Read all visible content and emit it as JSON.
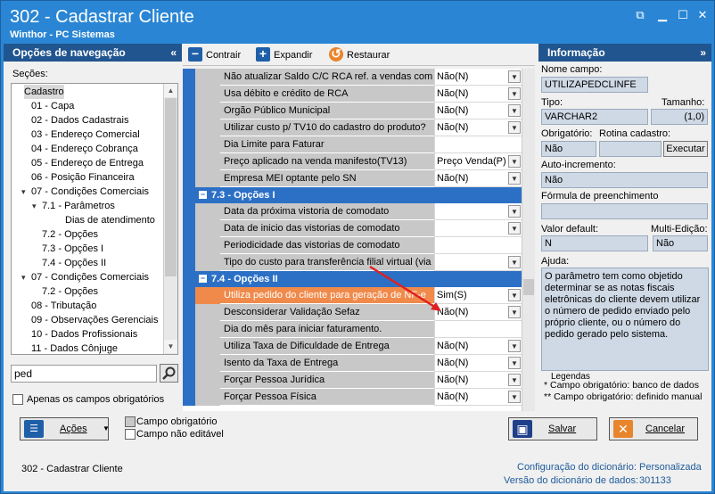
{
  "window": {
    "title": "302 - Cadastrar Cliente",
    "subtitle": "Winthor - PC Sistemas"
  },
  "nav": {
    "header": "Opções de navegação",
    "sections_label": "Seções:",
    "items": [
      {
        "label": "Cadastro",
        "level": 0,
        "twisty": ""
      },
      {
        "label": "01 - Capa",
        "level": 1,
        "twisty": ""
      },
      {
        "label": "02 - Dados Cadastrais",
        "level": 1,
        "twisty": ""
      },
      {
        "label": "03 - Endereço Comercial",
        "level": 1,
        "twisty": ""
      },
      {
        "label": "04 - Endereço Cobrança",
        "level": 1,
        "twisty": ""
      },
      {
        "label": "05 - Endereço de Entrega",
        "level": 1,
        "twisty": ""
      },
      {
        "label": "06 - Posição Financeira",
        "level": 1,
        "twisty": ""
      },
      {
        "label": "07 - Condições Comerciais",
        "level": 1,
        "twisty": "▾"
      },
      {
        "label": "7.1 - Parâmetros",
        "level": 2,
        "twisty": "▾"
      },
      {
        "label": "Dias de atendimento",
        "level": 3,
        "twisty": ""
      },
      {
        "label": "7.2 - Opções",
        "level": 2,
        "twisty": ""
      },
      {
        "label": "7.3 - Opções I",
        "level": 2,
        "twisty": ""
      },
      {
        "label": "7.4 - Opções II",
        "level": 2,
        "twisty": ""
      },
      {
        "label": "07 - Condições Comerciais",
        "level": 1,
        "twisty": "▾"
      },
      {
        "label": "7.2 - Opções",
        "level": 2,
        "twisty": ""
      },
      {
        "label": "08 - Tributação",
        "level": 1,
        "twisty": ""
      },
      {
        "label": "09 - Observações Gerenciais",
        "level": 1,
        "twisty": ""
      },
      {
        "label": "10 - Dados Profissionais",
        "level": 1,
        "twisty": ""
      },
      {
        "label": "11 - Dados Cônjuge",
        "level": 1,
        "twisty": ""
      }
    ],
    "search_value": "ped",
    "only_required_label": "Apenas os campos obrigatórios"
  },
  "toolbar": {
    "collapse": "Contrair",
    "expand": "Expandir",
    "restore": "Restaurar"
  },
  "grid": {
    "rows": [
      {
        "type": "row",
        "name": "Não atualizar Saldo C/C RCA ref. a vendas com D",
        "value": "Não(N)",
        "dd": true
      },
      {
        "type": "row",
        "name": "Usa débito e crédito de RCA",
        "value": "Não(N)",
        "dd": true
      },
      {
        "type": "row",
        "name": "Orgão Público Municipal",
        "value": "Não(N)",
        "dd": true
      },
      {
        "type": "row",
        "name": "Utilizar custo p/ TV10 do cadastro do produto?",
        "value": "Não(N)",
        "dd": true
      },
      {
        "type": "row",
        "name": "Dia Limite para Faturar",
        "value": "",
        "dd": false
      },
      {
        "type": "row",
        "name": "Preço aplicado na venda manifesto(TV13)",
        "value": "Preço Venda(P)",
        "dd": true
      },
      {
        "type": "row",
        "name": "Empresa MEI optante pelo SN",
        "value": "Não(N)",
        "dd": true
      },
      {
        "type": "group",
        "name": "7.3 - Opções I"
      },
      {
        "type": "row",
        "name": "Data da próxima vistoria de comodato",
        "value": "",
        "dd": true
      },
      {
        "type": "row",
        "name": "Data de inicio das vistorias de comodato",
        "value": "",
        "dd": true
      },
      {
        "type": "row",
        "name": "Periodicidade das vistorias de comodato",
        "value": "",
        "dd": false
      },
      {
        "type": "row",
        "name": "Tipo do custo  para transferência  filial virtual (via",
        "value": "",
        "dd": true
      },
      {
        "type": "group",
        "name": "7.4 - Opções II"
      },
      {
        "type": "row",
        "name": "Utiliza pedido do cliente para geração de NF-e",
        "value": "Sim(S)",
        "dd": true,
        "highlight": true
      },
      {
        "type": "row",
        "name": "Desconsiderar Validação Sefaz",
        "value": "Não(N)",
        "dd": true
      },
      {
        "type": "row",
        "name": "Dia do mês para iniciar faturamento.",
        "value": "",
        "dd": false
      },
      {
        "type": "row",
        "name": "Utiliza Taxa de Dificuldade de Entrega",
        "value": "Não(N)",
        "dd": true
      },
      {
        "type": "row",
        "name": "Isento da Taxa de Entrega",
        "value": "Não(N)",
        "dd": true
      },
      {
        "type": "row",
        "name": "Forçar Pessoa Jurídica",
        "value": "Não(N)",
        "dd": true
      },
      {
        "type": "row",
        "name": "Forçar Pessoa Física",
        "value": "Não(N)",
        "dd": true
      }
    ]
  },
  "info": {
    "header": "Informação",
    "field_name_label": "Nome campo:",
    "field_name": "UTILIZAPEDCLINFE",
    "type_label": "Tipo:",
    "size_label": "Tamanho:",
    "type": "VARCHAR2",
    "size": "(1,0)",
    "required_label": "Obrigatório:",
    "routine_label": "Rotina cadastro:",
    "required": "Não",
    "execute": "Executar",
    "autoinc_label": "Auto-incremento:",
    "autoinc": "Não",
    "formula_label": "Fórmula de preenchimento",
    "formula": "",
    "default_label": "Valor default:",
    "multi_label": "Multi-Edição:",
    "default": "N",
    "multi": "Não",
    "help_label": "Ajuda:",
    "help": "O parâmetro tem como objetido determinar se as notas fiscais eletrônicas do cliente devem utilizar o número de pedido enviado pelo próprio cliente, ou o número do pedido gerado pelo sistema.",
    "legend_title": "Legendas",
    "legend_1": "* Campo obrigatório: banco de dados",
    "legend_2": "** Campo obrigatório: definido manual"
  },
  "bottom": {
    "actions": "Ações",
    "legend_required": "Campo obrigatório",
    "legend_not_editable": "Campo não editável",
    "save": "Salvar",
    "cancel": "Cancelar",
    "status_left": "302 - Cadastrar Cliente",
    "dict_config_label": "Configuração do dicionário:",
    "dict_config": "Personalizada",
    "dict_version_label": "Versão do dicionário de dados:",
    "dict_version": "301133"
  },
  "colors": {
    "title_bar": "#2a86d4",
    "group_row": "#2c70c6",
    "highlight_row": "#f08a4b",
    "arrow": "#e02020"
  }
}
